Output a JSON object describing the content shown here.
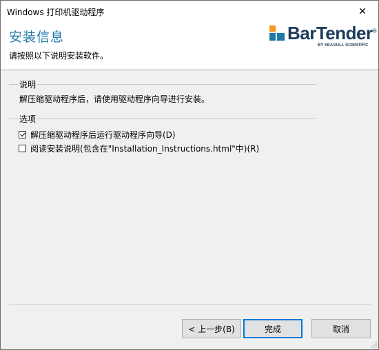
{
  "window": {
    "title": "Windows 打印机驱动程序",
    "close_glyph": "✕"
  },
  "header": {
    "title": "安装信息",
    "subtitle": "请按照以下说明安装软件。",
    "logo": {
      "brand": "BarTender",
      "registered": "®",
      "tagline": "BY SEAGULL SCIENTIFIC",
      "colors": {
        "orange": "#f39a1e",
        "blue": "#1f79a6",
        "navy": "#1d3c5a"
      }
    }
  },
  "description_group": {
    "label": "说明",
    "text": "解压缩驱动程序后，请使用驱动程序向导进行安装。"
  },
  "options_group": {
    "label": "选项",
    "options": [
      {
        "label": "解压缩驱动程序后运行驱动程序向导(D)",
        "checked": true
      },
      {
        "label": "阅读安装说明(包含在\"Installation_Instructions.html\"中)(R)",
        "checked": false
      }
    ]
  },
  "buttons": {
    "back": "< 上一步(B)",
    "finish": "完成",
    "cancel": "取消"
  }
}
